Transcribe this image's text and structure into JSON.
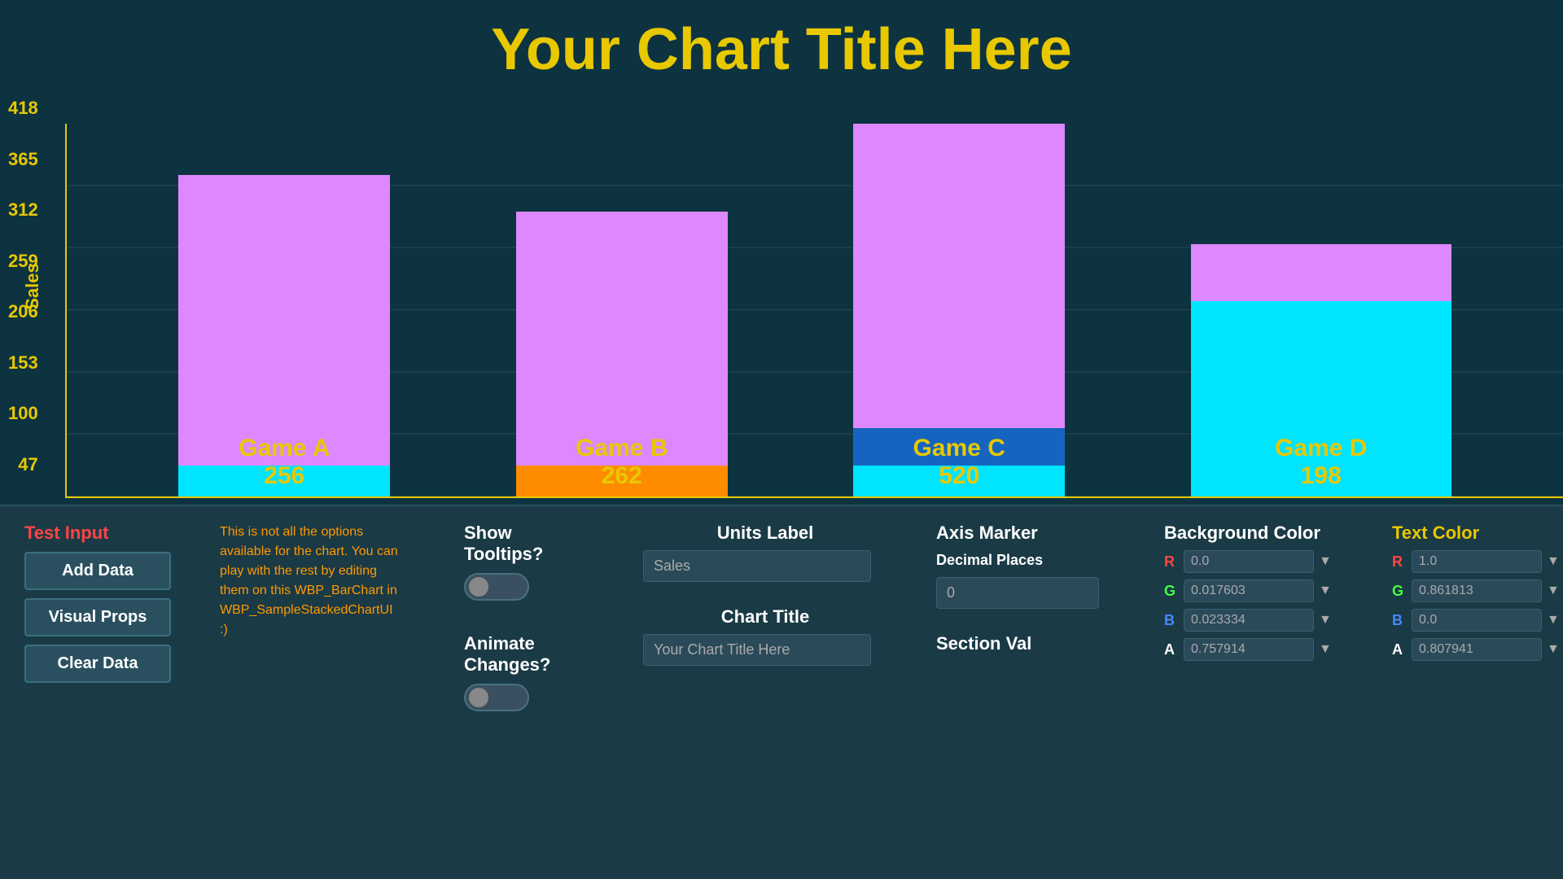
{
  "chart": {
    "title": "Your Chart Title Here",
    "y_axis_title": "Sales",
    "y_labels": [
      "418",
      "365",
      "312",
      "259",
      "206",
      "153",
      "100",
      "47"
    ],
    "bars": [
      {
        "name": "Game A",
        "value": 256,
        "total": 256,
        "top_color": "#dd88ff",
        "bottom_color": "#00e5ff",
        "top_height_pct": 85,
        "bottom_height_pct": 8
      },
      {
        "name": "Game B",
        "value": 262,
        "total": 262,
        "top_color": "#dd88ff",
        "bottom_color": "#ff8c00",
        "top_height_pct": 87,
        "bottom_height_pct": 8
      },
      {
        "name": "Game C",
        "value": 520,
        "total": 520,
        "top_color": "#dd88ff",
        "bottom_color": "#00e5ff",
        "mid_color": "#1565c0",
        "top_height_pct": 79,
        "mid_height_pct": 10,
        "bottom_height_pct": 8
      },
      {
        "name": "Game D",
        "value": 198,
        "total": 198,
        "top_color": "#dd88ff",
        "bottom_color": "#00e5ff",
        "top_height_pct": 18,
        "bottom_height_pct": 78
      }
    ]
  },
  "bottom": {
    "test_input_label": "Test Input",
    "add_data_label": "Add Data",
    "visual_props_label": "Visual Props",
    "clear_data_label": "Clear Data",
    "info_text": "This is not all the options available for the chart. You can play with the rest by editing them on this WBP_BarChart in WBP_SampleStackedChartUI :)",
    "show_tooltips_label": "Show Tooltips?",
    "animate_changes_label": "Animate Changes?",
    "units_label": "Units Label",
    "units_value": "Sales",
    "units_placeholder": "Sales",
    "chart_title_label": "Chart Title",
    "chart_title_value": "Your Chart Title Here",
    "chart_title_placeholder": "Your Chart Title Here",
    "axis_marker_label": "Axis Marker",
    "axis_marker_sub": "Decimal Places",
    "axis_marker_value": "0",
    "section_val_label": "Section Val",
    "bg_color_label": "Background Color",
    "bg_r": "0.0",
    "bg_g": "0.017603",
    "bg_b": "0.023334",
    "bg_a": "0.757914",
    "text_color_label": "Text Color",
    "txt_r": "1.0",
    "txt_g": "0.861813",
    "txt_b": "0.0",
    "txt_a": "0.807941"
  }
}
